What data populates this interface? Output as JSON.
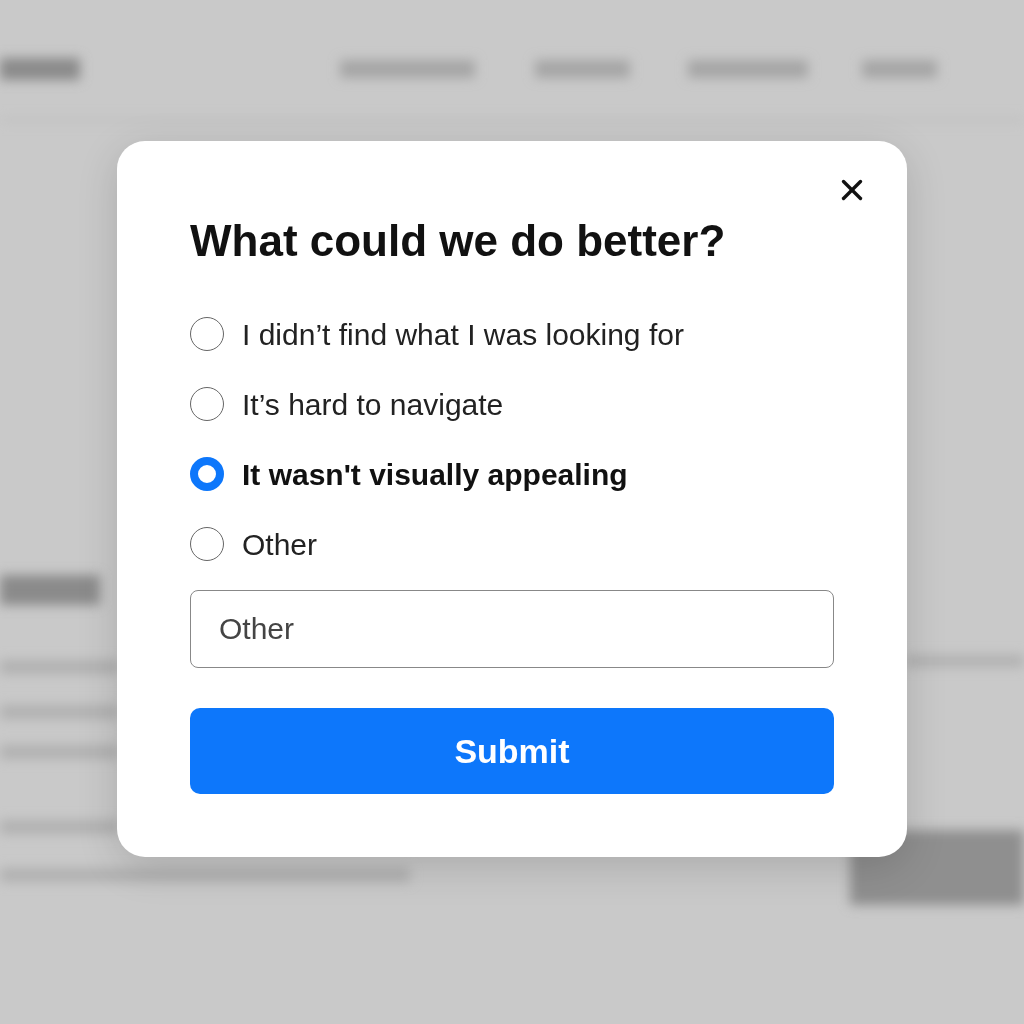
{
  "dialog": {
    "title": "What could we do better?",
    "options": [
      {
        "label": "I didn’t find what I was looking for",
        "selected": false
      },
      {
        "label": "It’s hard to navigate",
        "selected": false
      },
      {
        "label": "It wasn't visually appealing",
        "selected": true
      },
      {
        "label": "Other",
        "selected": false
      }
    ],
    "other_field": {
      "placeholder": "Other"
    },
    "submit": "Submit"
  }
}
